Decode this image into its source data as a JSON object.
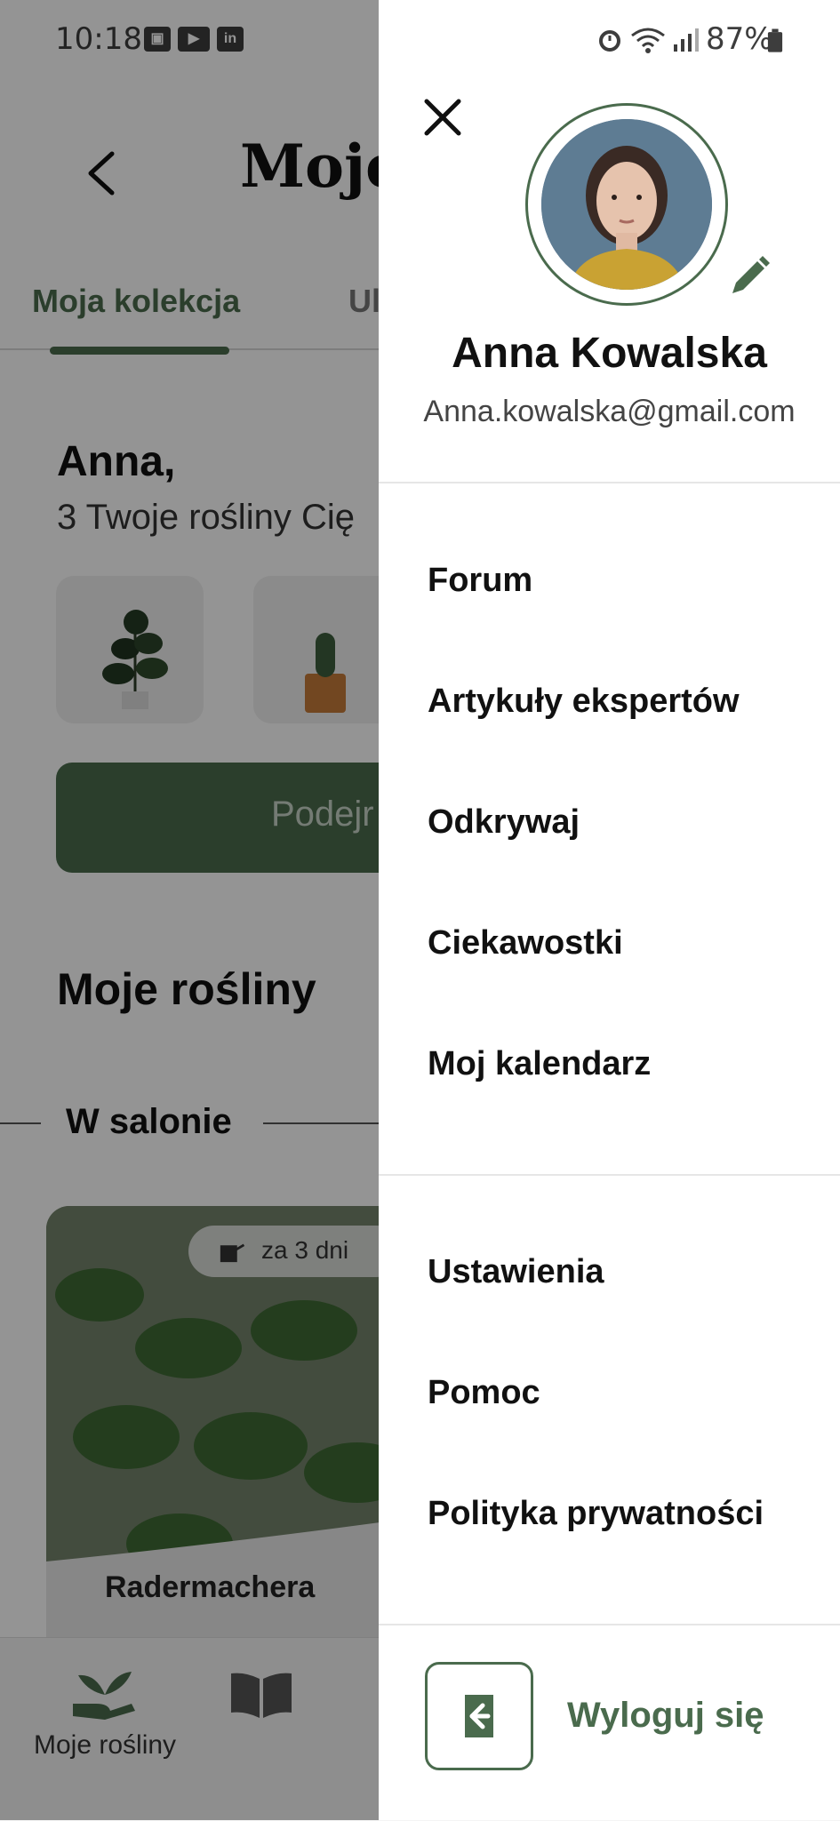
{
  "status_bar": {
    "time": "10:18",
    "battery": "87%"
  },
  "background_screen": {
    "title": "Moje",
    "tabs": [
      {
        "label": "Moja kolekcja",
        "active": true
      },
      {
        "label": "Ul",
        "active": false
      }
    ],
    "greeting": {
      "name": "Anna,",
      "subtitle": "3 Twoje rośliny Cię"
    },
    "cta_label": "Podejr",
    "section_title": "Moje rośliny",
    "room_label": "W salonie",
    "plant_card": {
      "watering": "za 3 dni",
      "name": "Radermachera"
    },
    "bottom_nav": [
      {
        "label": "Moje rośliny",
        "icon": "plant-hand-icon"
      },
      {
        "label": "",
        "icon": "book-icon"
      }
    ]
  },
  "drawer": {
    "user": {
      "name": "Anna Kowalska",
      "email": "Anna.kowalska@gmail.com"
    },
    "menu_primary": [
      {
        "label": "Forum"
      },
      {
        "label": "Artykuły ekspertów"
      },
      {
        "label": "Odkrywaj"
      },
      {
        "label": "Ciekawostki"
      },
      {
        "label": "Moj kalendarz"
      }
    ],
    "menu_secondary": [
      {
        "label": "Ustawienia"
      },
      {
        "label": "Pomoc"
      },
      {
        "label": "Polityka prywatności"
      }
    ],
    "logout_label": "Wyloguj się"
  },
  "colors": {
    "accent": "#4a6b4d",
    "scrim": "rgba(0,0,0,0.42)"
  }
}
